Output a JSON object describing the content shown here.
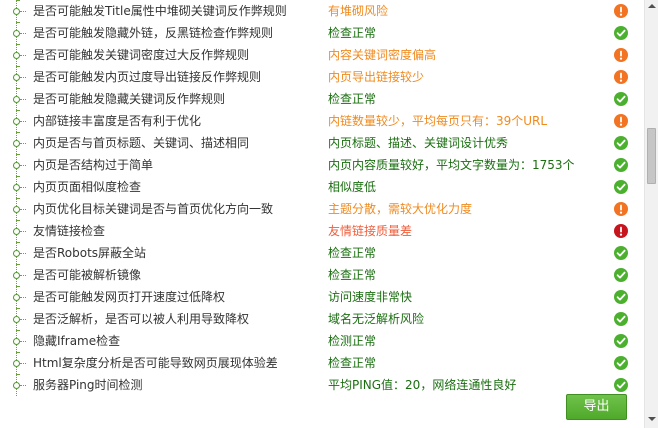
{
  "checks": [
    {
      "label": "是否可能触发Title属性中堆砌关键词反作弊规则",
      "result": "有堆砌风险",
      "level": "warn",
      "icon": "warning-icon"
    },
    {
      "label": "是否可能触发隐藏外链，反黑链检查作弊规则",
      "result": "检查正常",
      "level": "ok",
      "icon": "check-icon"
    },
    {
      "label": "是否可能触发关键词密度过大反作弊规则",
      "result": "内容关键词密度偏高",
      "level": "warn",
      "icon": "warning-icon"
    },
    {
      "label": "是否可能触发内页过度导出链接反作弊规则",
      "result": "内页导出链接较少",
      "level": "warn",
      "icon": "warning-icon"
    },
    {
      "label": "是否可能触发隐藏关键词反作弊规则",
      "result": "检查正常",
      "level": "ok",
      "icon": "check-icon"
    },
    {
      "label": "内部链接丰富度是否有利于优化",
      "result": "内链数量较少，平均每页只有：39个URL",
      "level": "warn",
      "icon": "warning-icon"
    },
    {
      "label": "内页是否与首页标题、关键词、描述相同",
      "result": "内页标题、描述、关键词设计优秀",
      "level": "ok",
      "icon": "check-icon"
    },
    {
      "label": "内页是否结构过于简单",
      "result": "内页内容质量较好，平均文字数量为：1753个",
      "level": "ok",
      "icon": "check-icon"
    },
    {
      "label": "内页页面相似度检查",
      "result": "相似度低",
      "level": "ok",
      "icon": "check-icon"
    },
    {
      "label": "内页优化目标关键词是否与首页优化方向一致",
      "result": "主题分散，需较大优化力度",
      "level": "warn",
      "icon": "warning-icon"
    },
    {
      "label": "友情链接检查",
      "result": "友情链接质量差",
      "level": "err",
      "icon": "error-icon"
    },
    {
      "label": "是否Robots屏蔽全站",
      "result": "检查正常",
      "level": "ok",
      "icon": "check-icon"
    },
    {
      "label": "是否可能被解析镜像",
      "result": "检查正常",
      "level": "ok",
      "icon": "check-icon"
    },
    {
      "label": "是否可能触发网页打开速度过低降权",
      "result": "访问速度非常快",
      "level": "ok",
      "icon": "check-icon"
    },
    {
      "label": "是否泛解析，是否可以被人利用导致降权",
      "result": "域名无泛解析风险",
      "level": "ok",
      "icon": "check-icon"
    },
    {
      "label": "隐藏Iframe检查",
      "result": "检测正常",
      "level": "ok",
      "icon": "check-icon"
    },
    {
      "label": "Html复杂度分析是否可能导致网页展现体验差",
      "result": "检查正常",
      "level": "ok",
      "icon": "check-icon"
    },
    {
      "label": "服务器Ping时间检测",
      "result": "平均PING值：20，网络连通性良好",
      "level": "ok",
      "icon": "check-icon"
    }
  ],
  "export_label": "导出",
  "colors": {
    "ok_text": "#1a6e10",
    "warn_text": "#f08a1e",
    "err_text": "#f05d3a",
    "ok_icon": "#4cb02f",
    "warn_icon": "#f27321",
    "err_icon": "#c8141d",
    "button": "#5cb43a"
  }
}
